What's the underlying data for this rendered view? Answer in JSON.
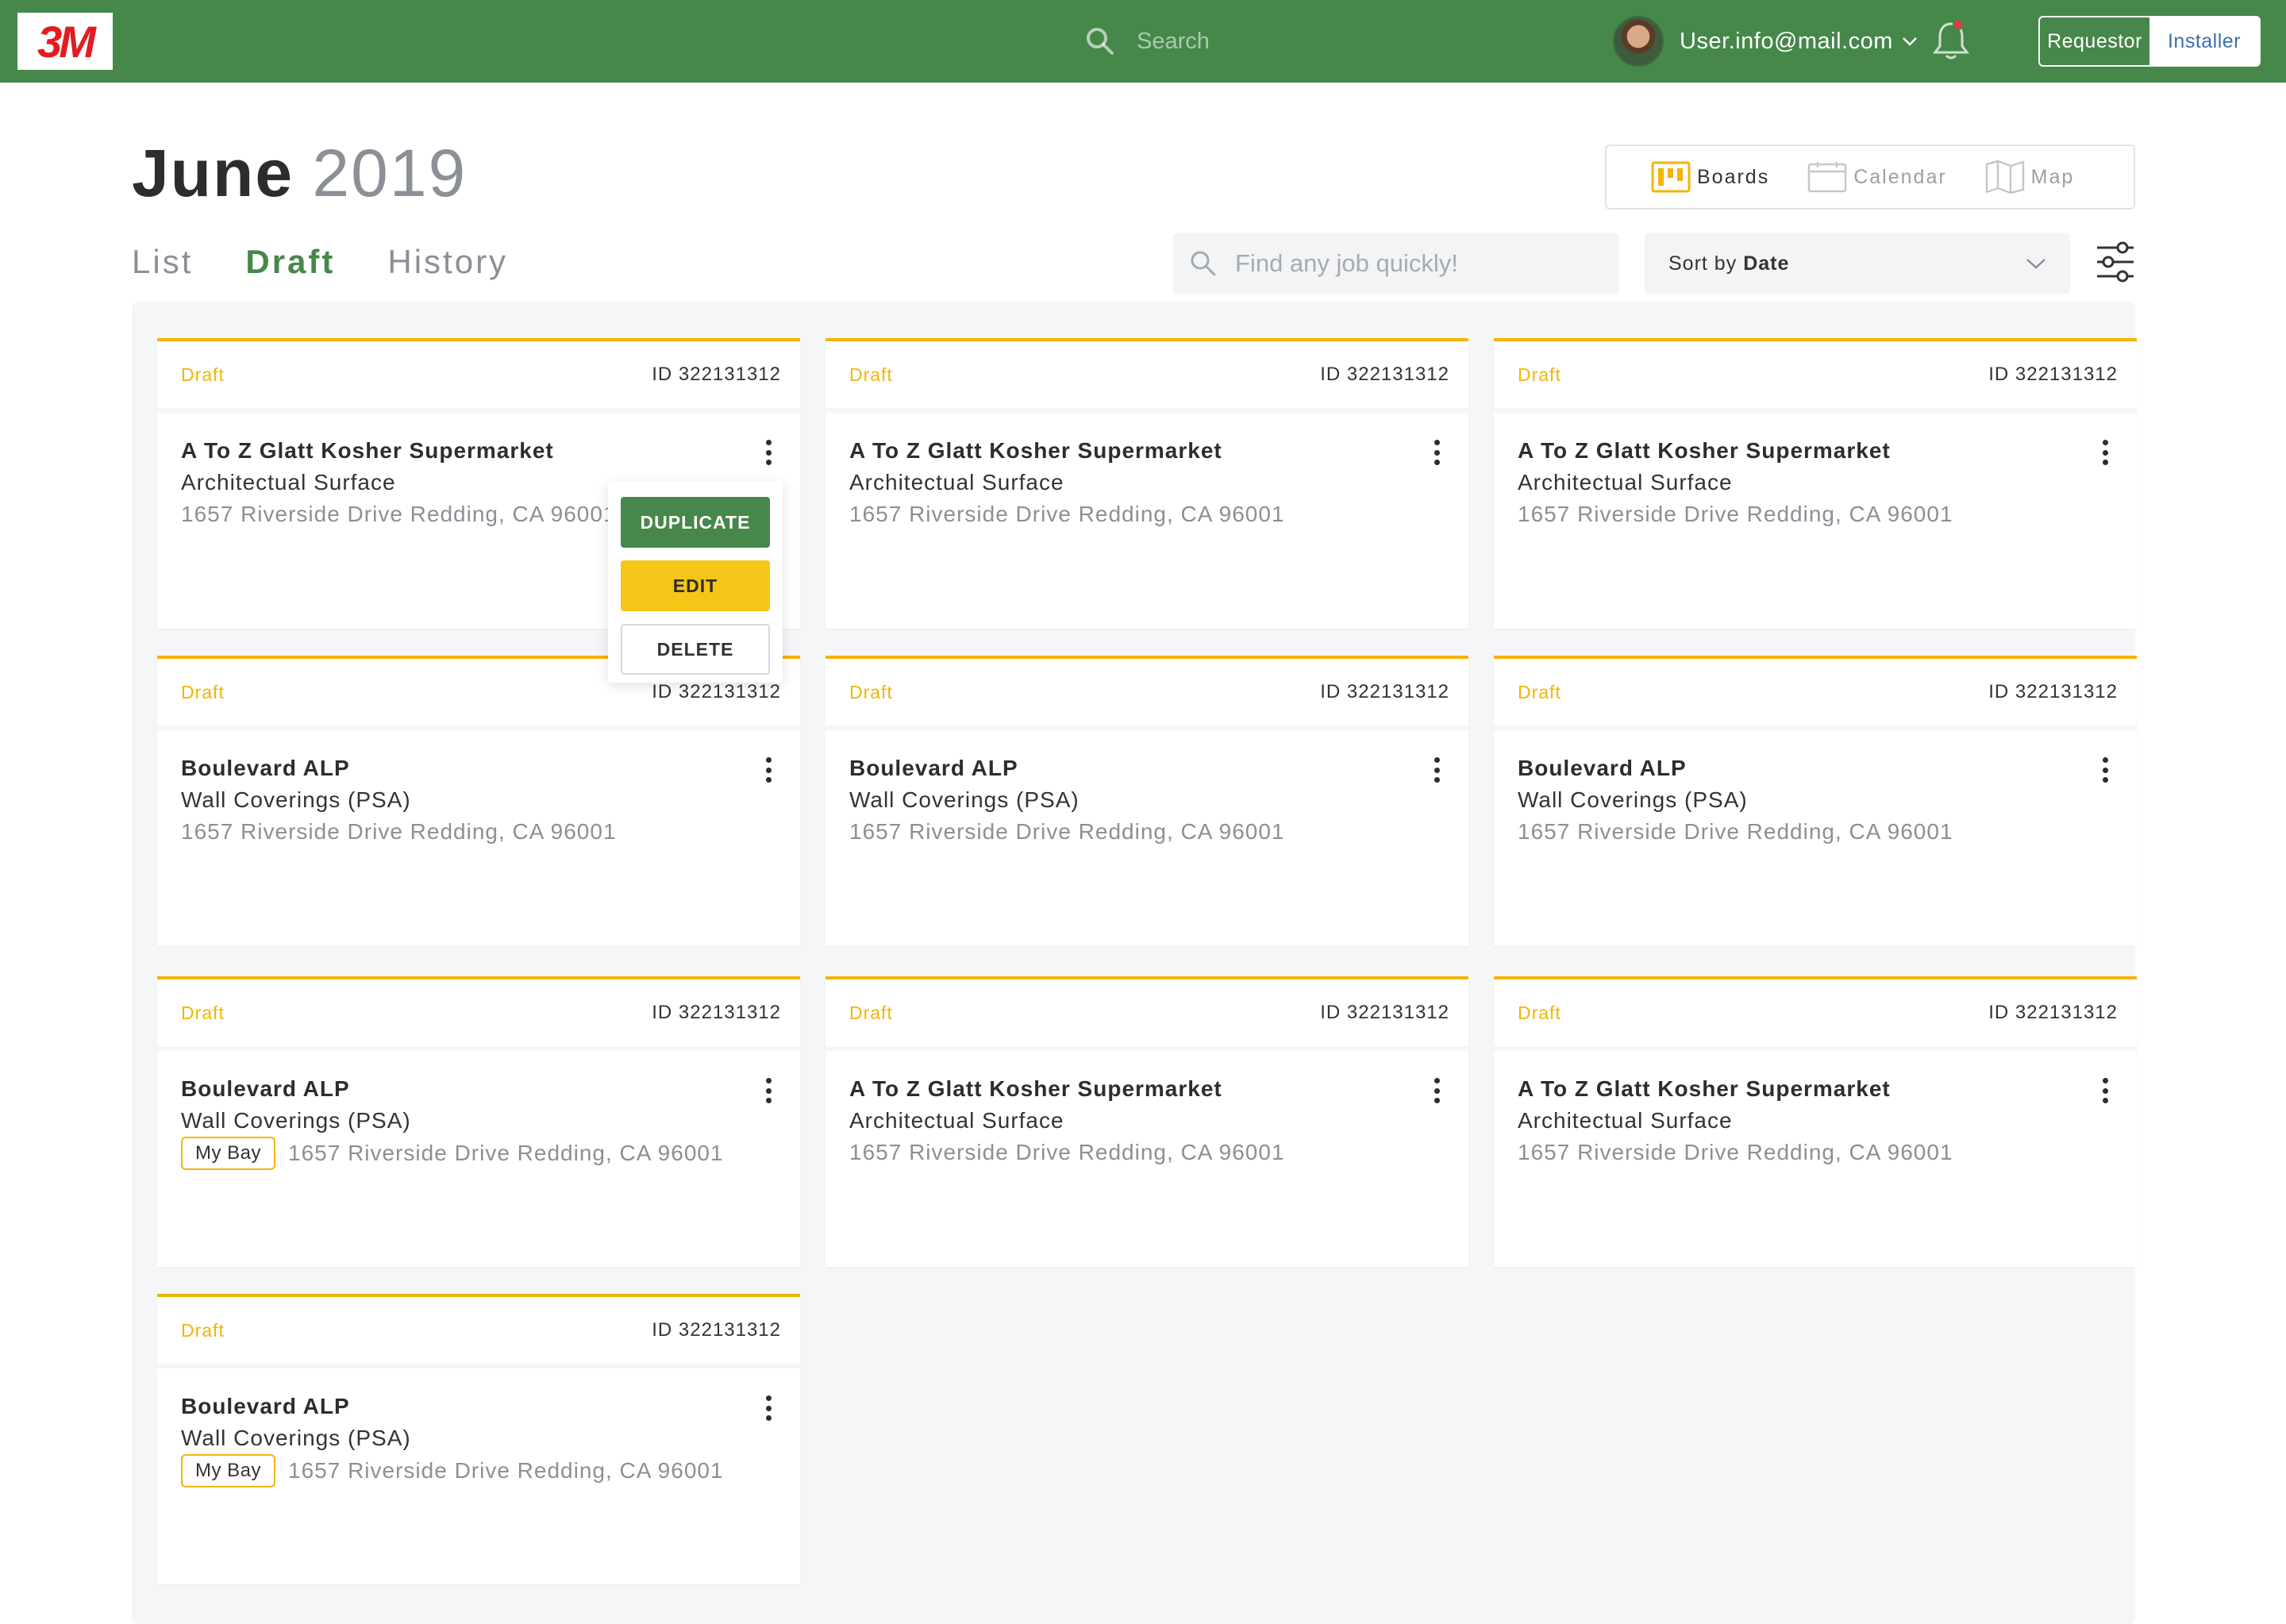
{
  "brand": {
    "logo_text": "3M",
    "accent": "#46874a",
    "status_color": "#f4b400",
    "logo_color": "#e51a21"
  },
  "topbar": {
    "search_placeholder": "Search",
    "user_email": "User.info@mail.com",
    "roles": [
      "Requestor",
      "Installer"
    ],
    "active_role": "Installer"
  },
  "header": {
    "month": "June",
    "year": "2019",
    "views": [
      {
        "label": "Boards",
        "icon": "boards-icon",
        "active": true
      },
      {
        "label": "Calendar",
        "icon": "calendar-icon",
        "active": false
      },
      {
        "label": "Map",
        "icon": "map-icon",
        "active": false
      }
    ],
    "tabs": [
      {
        "label": "List",
        "active": false
      },
      {
        "label": "Draft",
        "active": true
      },
      {
        "label": "History",
        "active": false
      }
    ],
    "job_search_placeholder": "Find any job quickly!",
    "sort_label": "Sort by",
    "sort_value": "Date"
  },
  "cards": [
    {
      "status": "Draft",
      "id": "ID 322131312",
      "customer": "A To Z Glatt Kosher Supermarket",
      "category": "Architectual Surface",
      "address": "1657 Riverside Drive Redding, CA 96001",
      "badge": ""
    },
    {
      "status": "Draft",
      "id": "ID 322131312",
      "customer": "A To Z Glatt Kosher Supermarket",
      "category": "Architectual Surface",
      "address": "1657 Riverside Drive Redding, CA 96001",
      "badge": ""
    },
    {
      "status": "Draft",
      "id": "ID 322131312",
      "customer": "A To Z Glatt Kosher Supermarket",
      "category": "Architectual Surface",
      "address": "1657 Riverside Drive Redding, CA 96001",
      "badge": ""
    },
    {
      "status": "Draft",
      "id": "ID 322131312",
      "customer": "Boulevard ALP",
      "category": "Wall Coverings (PSA)",
      "address": "1657 Riverside Drive Redding, CA 96001",
      "badge": ""
    },
    {
      "status": "Draft",
      "id": "ID 322131312",
      "customer": "Boulevard ALP",
      "category": "Wall Coverings (PSA)",
      "address": "1657 Riverside Drive Redding, CA 96001",
      "badge": ""
    },
    {
      "status": "Draft",
      "id": "ID 322131312",
      "customer": "Boulevard ALP",
      "category": "Wall Coverings (PSA)",
      "address": "1657 Riverside Drive Redding, CA 96001",
      "badge": ""
    },
    {
      "status": "Draft",
      "id": "ID 322131312",
      "customer": "Boulevard ALP",
      "category": "Wall Coverings (PSA)",
      "address": "1657 Riverside Drive Redding, CA 96001",
      "badge": "My Bay"
    },
    {
      "status": "Draft",
      "id": "ID 322131312",
      "customer": "A To Z Glatt Kosher Supermarket",
      "category": "Architectual Surface",
      "address": "1657 Riverside Drive Redding, CA 96001",
      "badge": ""
    },
    {
      "status": "Draft",
      "id": "ID 322131312",
      "customer": "A To Z Glatt Kosher Supermarket",
      "category": "Architectual Surface",
      "address": "1657 Riverside Drive Redding, CA 96001",
      "badge": ""
    },
    {
      "status": "Draft",
      "id": "ID 322131312",
      "customer": "Boulevard ALP",
      "category": "Wall Coverings (PSA)",
      "address": "1657 Riverside Drive Redding, CA 96001",
      "badge": "My Bay"
    }
  ],
  "context_menu": {
    "duplicate": "DUPLICATE",
    "edit": "EDIT",
    "delete": "DELETE"
  }
}
